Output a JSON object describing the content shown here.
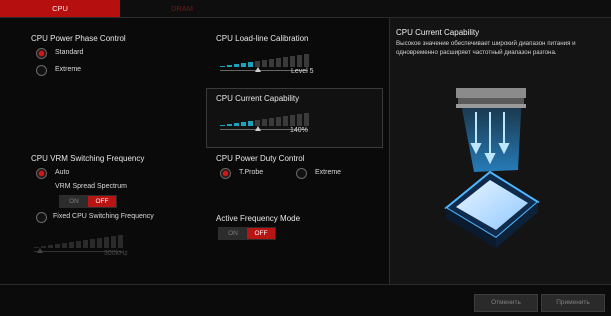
{
  "tabs": [
    {
      "label": "CPU"
    },
    {
      "label": "DRAM"
    }
  ],
  "left": {
    "power_phase": {
      "title": "CPU Power Phase Control",
      "options": [
        {
          "label": "Standard",
          "selected": true
        },
        {
          "label": "Extreme",
          "selected": false
        }
      ]
    },
    "vrm_switching": {
      "title": "CPU VRM Switching Frequency",
      "auto_label": "Auto",
      "auto_selected": true,
      "spread_spectrum_title": "VRM Spread Spectrum",
      "spread_toggle": {
        "on_label": "ON",
        "off_label": "OFF",
        "value": "OFF"
      },
      "fixed_label": "Fixed CPU Switching Frequency",
      "fixed_selected": false,
      "fixed_value": "300kHz"
    }
  },
  "middle": {
    "llc": {
      "title": "CPU Load-line Calibration",
      "value": "Level 5",
      "level_fraction": 0.4
    },
    "current_capability": {
      "title": "CPU Current Capability",
      "value": "140%",
      "level_fraction": 0.4
    },
    "power_duty": {
      "title": "CPU Power Duty Control",
      "options": [
        {
          "label": "T.Probe",
          "selected": true
        },
        {
          "label": "Extreme",
          "selected": false
        }
      ]
    },
    "active_frequency": {
      "title": "Active Frequency Mode",
      "toggle": {
        "on_label": "ON",
        "off_label": "OFF",
        "value": "OFF"
      }
    }
  },
  "right": {
    "title": "CPU Current Capability",
    "description": "Высокое значение обеспечивает широкий диапазон питания и одновременно расширяет частотный диапазон разгона."
  },
  "footer": {
    "cancel_label": "Отменить",
    "apply_label": "Применить"
  },
  "colors": {
    "accent_red": "#b50f0f",
    "slider_blue": "#1aa3bf",
    "background": "#0a0a0a"
  }
}
